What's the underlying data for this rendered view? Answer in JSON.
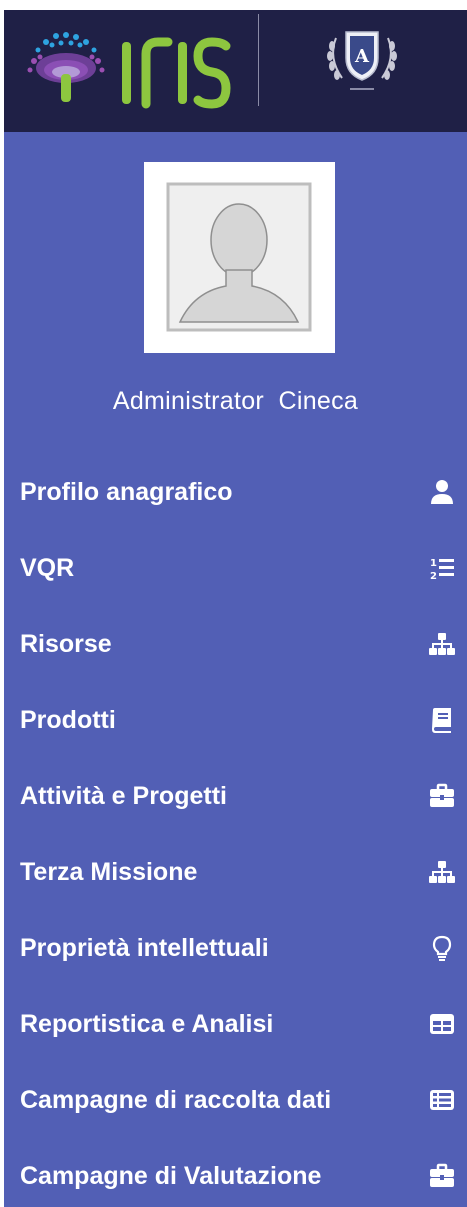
{
  "header": {
    "logo_text": "IRIS"
  },
  "user": {
    "name": "Administrator  Cineca"
  },
  "menu": {
    "items": [
      {
        "label": "Profilo anagrafico",
        "icon": "user-icon"
      },
      {
        "label": "VQR",
        "icon": "ordered-list-icon"
      },
      {
        "label": "Risorse",
        "icon": "sitemap-icon"
      },
      {
        "label": "Prodotti",
        "icon": "book-icon"
      },
      {
        "label": "Attività e Progetti",
        "icon": "briefcase-icon"
      },
      {
        "label": "Terza Missione",
        "icon": "sitemap-icon"
      },
      {
        "label": "Proprietà intellettuali",
        "icon": "lightbulb-icon"
      },
      {
        "label": "Reportistica e Analisi",
        "icon": "table-icon"
      },
      {
        "label": "Campagne di raccolta dati",
        "icon": "list-alt-icon"
      },
      {
        "label": "Campagne di Valutazione",
        "icon": "briefcase-icon"
      }
    ]
  },
  "colors": {
    "header_bg": "#1f2046",
    "sidebar_bg": "#525fb5",
    "logo_green": "#8dc63f",
    "text": "#ffffff"
  }
}
